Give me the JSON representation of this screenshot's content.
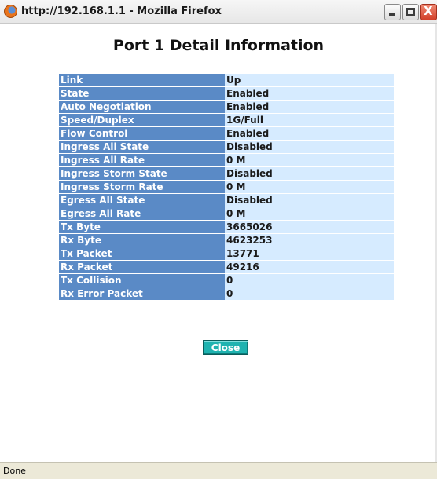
{
  "window": {
    "title": "http://192.168.1.1 - Mozilla Firefox",
    "icon": "firefox-icon",
    "close_glyph": "X"
  },
  "page": {
    "title": "Port 1 Detail Information"
  },
  "details": [
    {
      "label": "Link",
      "value": "Up"
    },
    {
      "label": "State",
      "value": "Enabled"
    },
    {
      "label": "Auto Negotiation",
      "value": "Enabled"
    },
    {
      "label": "Speed/Duplex",
      "value": "1G/Full"
    },
    {
      "label": "Flow Control",
      "value": "Enabled"
    },
    {
      "label": "Ingress All State",
      "value": "Disabled"
    },
    {
      "label": "Ingress All Rate",
      "value": "0 M"
    },
    {
      "label": "Ingress Storm State",
      "value": "Disabled"
    },
    {
      "label": "Ingress Storm Rate",
      "value": "0 M"
    },
    {
      "label": "Egress All State",
      "value": "Disabled"
    },
    {
      "label": "Egress All Rate",
      "value": "0 M"
    },
    {
      "label": "Tx Byte",
      "value": "3665026"
    },
    {
      "label": "Rx Byte",
      "value": "4623253"
    },
    {
      "label": "Tx Packet",
      "value": "13771"
    },
    {
      "label": "Rx Packet",
      "value": "49216"
    },
    {
      "label": "Tx Collision",
      "value": "0"
    },
    {
      "label": "Rx Error Packet",
      "value": "0"
    }
  ],
  "actions": {
    "close_label": "Close"
  },
  "statusbar": {
    "text": "Done"
  },
  "colors": {
    "label_bg": "#5a8ac6",
    "value_bg": "#d6ebff",
    "button_bg": "#1fb3b0"
  }
}
